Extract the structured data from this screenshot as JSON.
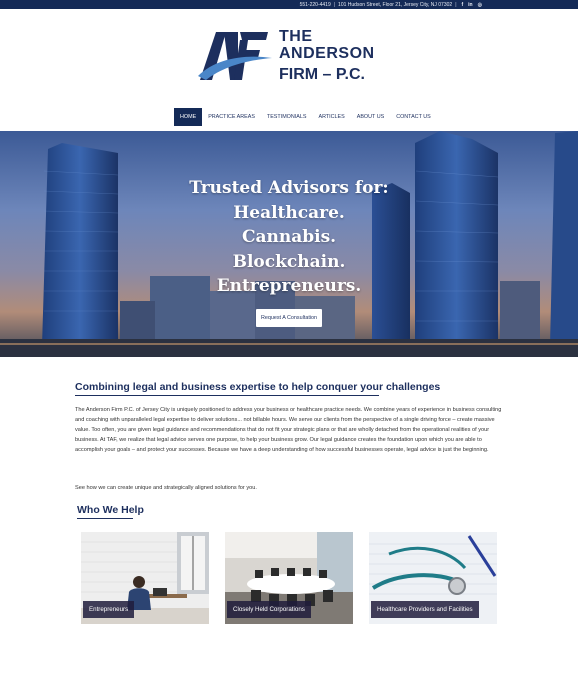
{
  "topbar": {
    "phone": "551-220-4419",
    "address": "101 Hudson Street, Floor 21, Jersey City, NJ 07302",
    "social": [
      "f",
      "in",
      "◎"
    ]
  },
  "logo": {
    "line1": "THE",
    "line2": "ANDERSON",
    "line3": "FIRM – P.C."
  },
  "nav": {
    "items": [
      "HOME",
      "PRACTICE AREAS",
      "TESTIMONIALS",
      "ARTICLES",
      "ABOUT US",
      "CONTACT US"
    ],
    "active": "HOME"
  },
  "hero": {
    "lines": [
      "Trusted Advisors for:",
      "Healthcare.",
      "Cannabis.",
      "Blockchain.",
      "Entrepreneurs."
    ],
    "cta": "Request A Consultation"
  },
  "intro": {
    "title": "Combining legal and business expertise to help conquer your challenges",
    "body": "The Anderson Firm P.C. of Jersey City is uniquely positioned to address your business or healthcare practice needs. We combine years of experience in business consulting and coaching with unparalleled legal expertise to deliver solutions... not billable hours. We serve our clients from the perspective of a single driving force – create massive value. Too often, you are given legal guidance and recommendations that do not fit your strategic plans or that are wholly detached from the operational realities of your business. At TAF, we realize that legal advice serves one purpose, to help your business grow. Our legal guidance creates the foundation upon which you are able to accomplish your goals – and protect your successes. Because we have a deep understanding of how successful businesses operate, legal advice is just the beginning.",
    "cta_text": "See how we can create unique and strategically aligned solutions for you."
  },
  "who": {
    "title": "Who We Help",
    "cards": [
      {
        "label": "Entrepreneurs"
      },
      {
        "label": "Closely Held Corporations"
      },
      {
        "label": "Healthcare Providers and Facilities"
      }
    ]
  },
  "colors": {
    "navy": "#142a57",
    "brand_text": "#1d2f5e"
  }
}
